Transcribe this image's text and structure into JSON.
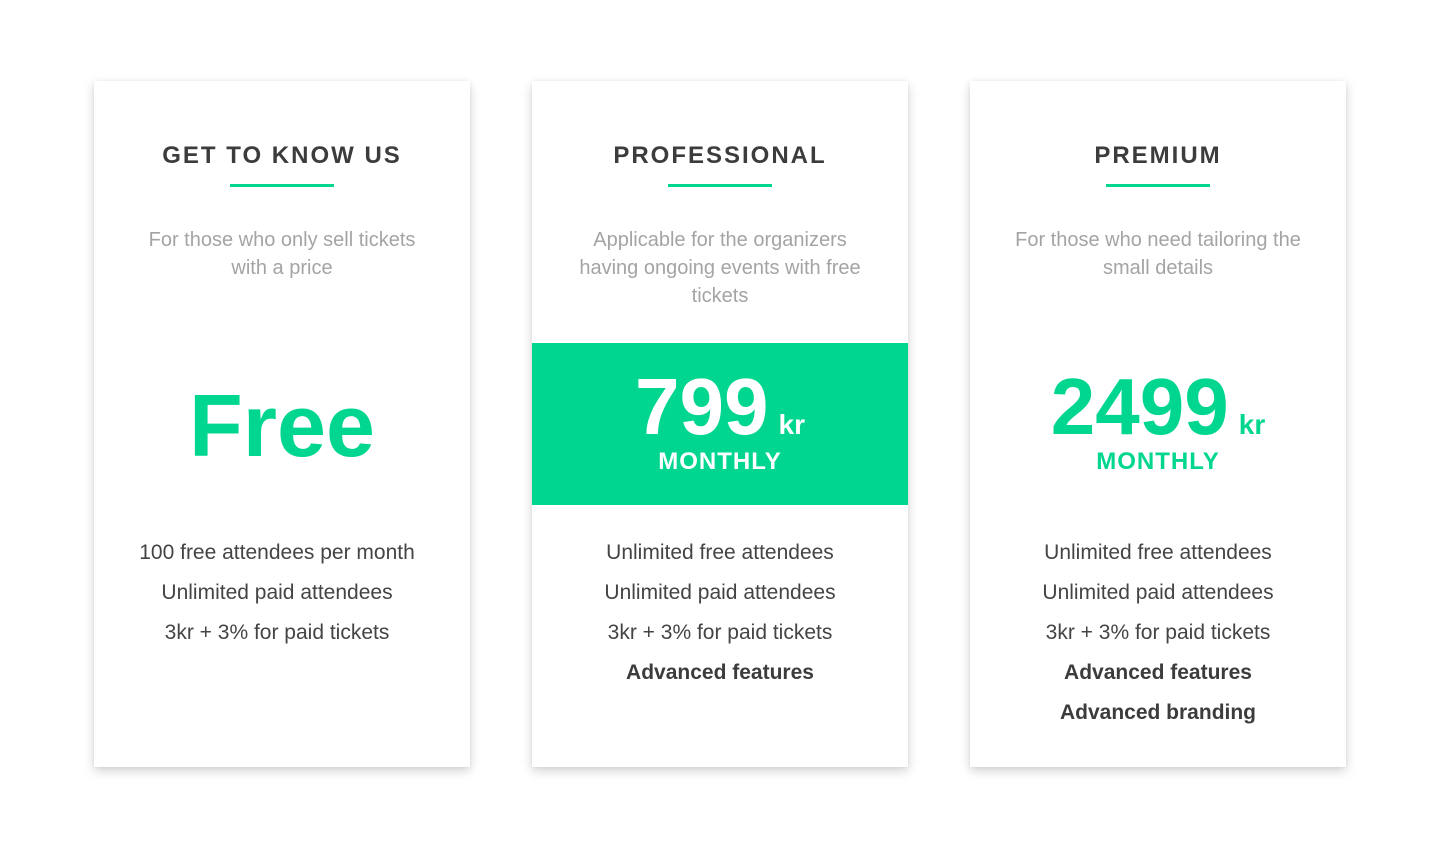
{
  "colors": {
    "accent": "#00d68f",
    "title": "#3c3c3c",
    "description": "#a4a4a4",
    "feature_text": "#444444",
    "background": "#ffffff"
  },
  "plans": [
    {
      "title": "GET TO KNOW US",
      "description": "For those who only sell tickets with a price",
      "price_label": "Free",
      "features": [
        "100 free attendees per month",
        "Unlimited paid attendees",
        "3kr + 3% for paid tickets"
      ]
    },
    {
      "title": "PROFESSIONAL",
      "description": "Applicable for the organizers having ongoing events with free tickets",
      "price": "799",
      "currency": "kr",
      "period": "MONTHLY",
      "highlighted": true,
      "features": [
        "Unlimited free attendees",
        "Unlimited paid attendees",
        "3kr + 3% for paid tickets",
        "Advanced features"
      ]
    },
    {
      "title": "PREMIUM",
      "description": "For those who need tailoring the small details",
      "price": "2499",
      "currency": "kr",
      "period": "MONTHLY",
      "features": [
        "Unlimited free attendees",
        "Unlimited paid attendees",
        "3kr + 3% for paid tickets",
        "Advanced features",
        "Advanced branding"
      ]
    }
  ]
}
